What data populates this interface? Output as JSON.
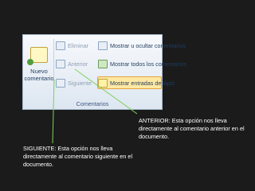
{
  "ribbon": {
    "new_comment": "Nuevo comentario",
    "delete": "Eliminar",
    "previous": "Anterior",
    "next": "Siguiente",
    "show_hide": "Mostrar u ocultar comentarios",
    "show_all": "Mostrar todos los comentarios",
    "show_ink": "Mostrar entradas de lápiz",
    "group_label": "Comentarios"
  },
  "notes": {
    "anterior": "ANTERIOR: Esta opción nos lleva directamente al comentario anterior en el documento.",
    "siguiente": "SIGUIENTE: Esta opción nos lleva directamente al comentario siguiente en el documento."
  },
  "colors": {
    "background": "#1b1b1b",
    "arrow": "#7fd15a",
    "text": "#ffffff"
  }
}
